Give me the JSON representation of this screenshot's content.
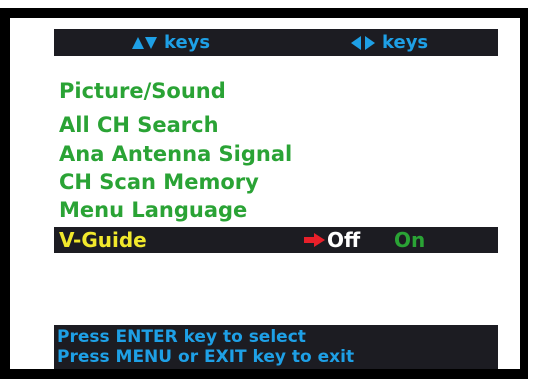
{
  "keys_bar": {
    "updown_label": "keys",
    "updown_icon": "up-down-arrows-icon",
    "leftright_label": "keys",
    "leftright_icon": "left-right-arrows-icon"
  },
  "menu": {
    "items": [
      {
        "label": "Picture/Sound"
      },
      {
        "label": "All CH Search"
      },
      {
        "label": "Ana Antenna Signal"
      },
      {
        "label": "CH Scan Memory"
      },
      {
        "label": "Menu Language"
      }
    ],
    "selected": {
      "label": "V-Guide",
      "pointer_icon": "red-arrow-pointer-icon",
      "options": [
        "Off",
        "On"
      ],
      "current_value": "Off"
    }
  },
  "help": {
    "line1": "Press ENTER key to select",
    "line2": "Press MENU or EXIT key to exit"
  },
  "colors": {
    "bar_background": "#1c1c22",
    "menu_text": "#2aa335",
    "selected_text": "#f1e82c",
    "key_text": "#1ea0e6",
    "pointer": "#e8202a",
    "frame": "#000000"
  }
}
